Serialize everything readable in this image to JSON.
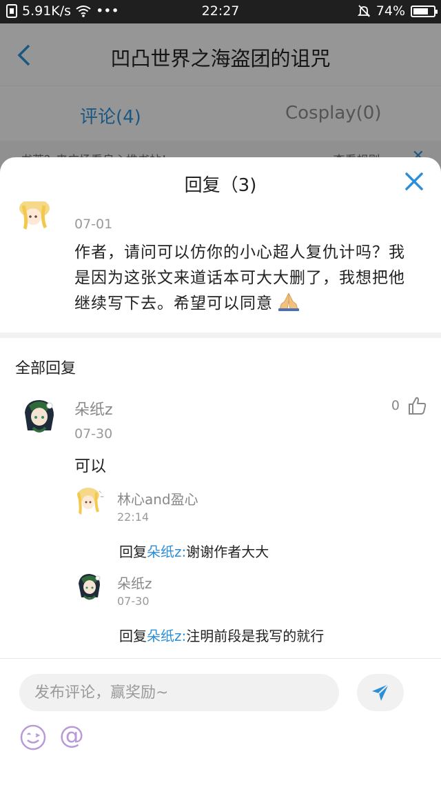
{
  "status_bar": {
    "speed": "5.91K/s",
    "dots": "•••",
    "time": "22:27",
    "battery": "74%",
    "battery_level": 0.74
  },
  "background_page": {
    "title": "凹凸世界之海盗团的诅咒",
    "tabs": [
      {
        "label": "评论(4)",
        "active": true
      },
      {
        "label": "Cosplay(0)",
        "active": false
      }
    ],
    "notice_left": "书荒？来广场看良心推书帖！",
    "notice_right": "查看规则>>"
  },
  "sheet": {
    "title": "回复（3)",
    "main_comment": {
      "date": "07-01",
      "text": "作者，请问可以仿你的小心超人复仇计吗？我是因为这张文来道话本可大大删了，我想把他继续写下去。希望可以同意"
    },
    "all_replies_label": "全部回复",
    "reply": {
      "name": "朵纸z",
      "date": "07-30",
      "likes": "0",
      "text": "可以",
      "sub_replies": [
        {
          "name": "林心and盈心",
          "date": "22:14",
          "prefix": "回复",
          "mention": "朵纸z:",
          "text": "谢谢作者大大"
        },
        {
          "name": "朵纸z",
          "date": "07-30",
          "prefix": "回复",
          "mention": "朵纸z:",
          "text": "注明前段是我写的就行"
        }
      ]
    }
  },
  "composer": {
    "placeholder": "发布评论，赢奖励~",
    "at_symbol": "@"
  },
  "colors": {
    "accent": "#2b8ed6",
    "icon_purple": "#b99ad8"
  }
}
